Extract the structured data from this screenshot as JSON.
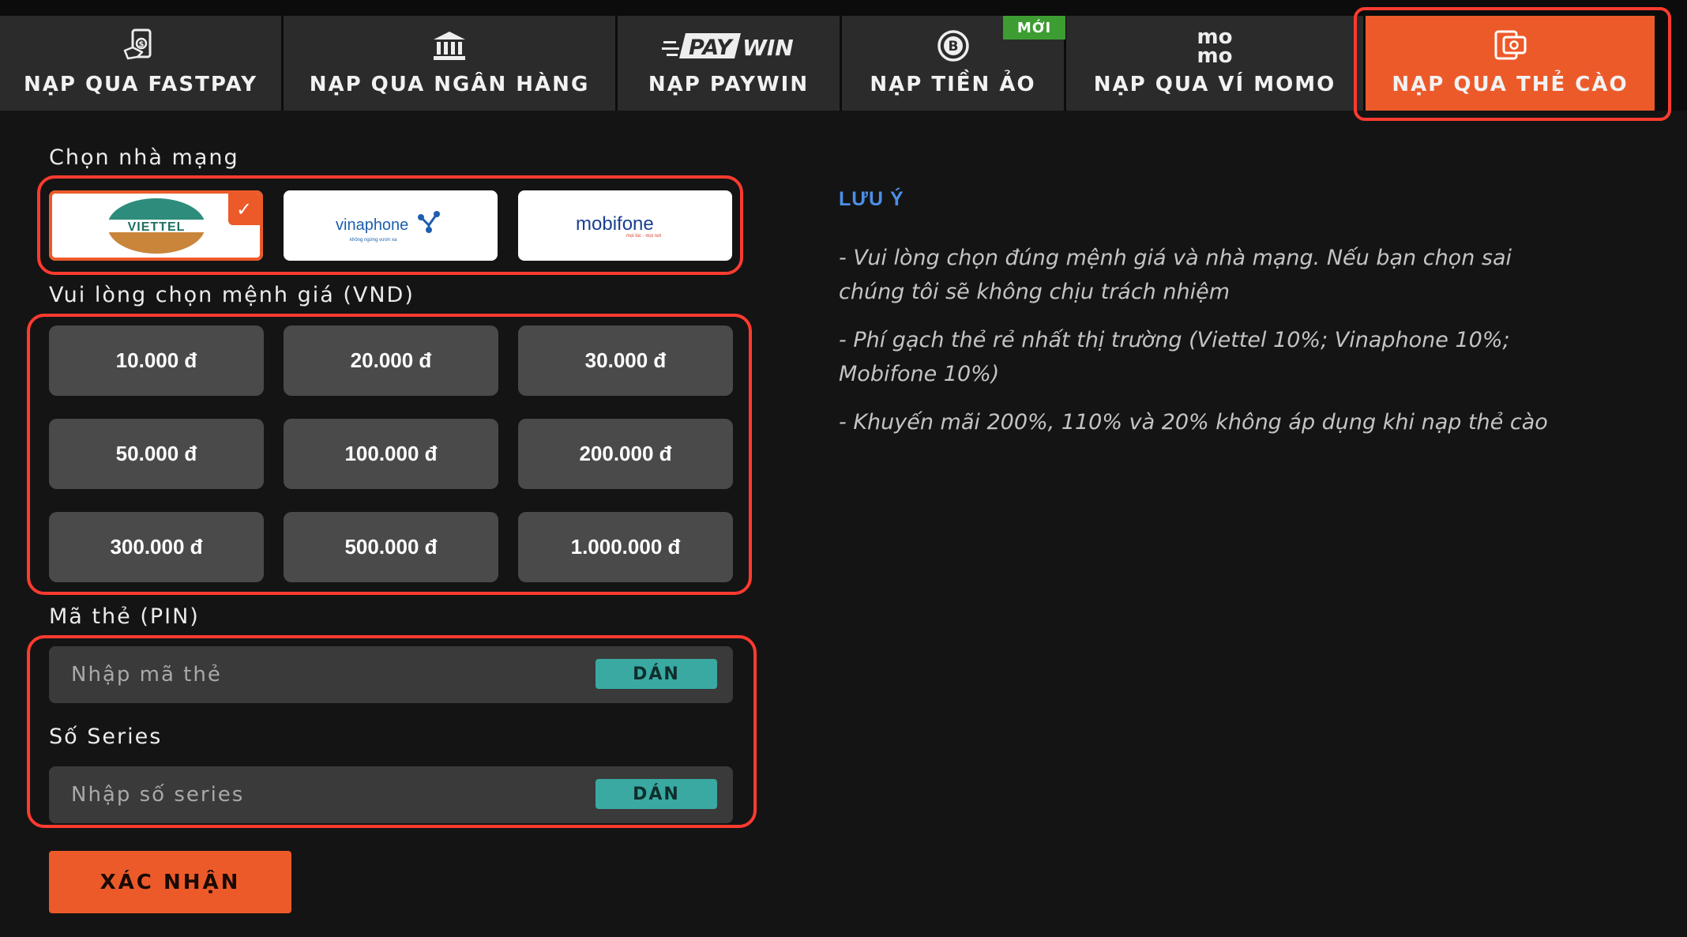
{
  "colors": {
    "accent": "#ec5a2a",
    "highlight_outline": "#ff3b30",
    "paste_button": "#3aa9a2",
    "note_title": "#4a8fe7",
    "new_badge": "#3d9d32"
  },
  "tabs": [
    {
      "label": "NẠP QUA FASTPAY",
      "icon": "money-hand-icon"
    },
    {
      "label": "NẠP QUA NGÂN HÀNG",
      "icon": "bank-icon"
    },
    {
      "label": "NẠP PAYWIN",
      "icon": "paywin-logo",
      "logo_text": [
        "PAY",
        "WIN"
      ]
    },
    {
      "label": "NẠP TIỀN ẢO",
      "icon": "bitcoin-icon"
    },
    {
      "label": "NẠP QUA VÍ MOMO",
      "icon": "momo-logo",
      "logo_text": [
        "mo",
        "mo"
      ]
    },
    {
      "label": "NẠP QUA THẺ CÀO",
      "icon": "card-icon",
      "active": true
    }
  ],
  "new_badge": "MỚI",
  "carrier_section": {
    "label": "Chọn nhà mạng",
    "carriers": [
      {
        "name": "viettel",
        "logo_text": "VIETTEL",
        "selected": true
      },
      {
        "name": "vinaphone",
        "logo_text": "vinaphone",
        "tagline": "không ngừng vươn xa"
      },
      {
        "name": "mobifone",
        "logo_text": "mobifone",
        "tagline": "mọi lúc - mọi nơi"
      }
    ]
  },
  "amount_section": {
    "label": "Vui lòng chọn mệnh giá (VND)",
    "amounts": [
      "10.000 đ",
      "20.000 đ",
      "30.000 đ",
      "50.000 đ",
      "100.000 đ",
      "200.000 đ",
      "300.000 đ",
      "500.000 đ",
      "1.000.000 đ"
    ]
  },
  "pin": {
    "label": "Mã thẻ (PIN)",
    "placeholder": "Nhập mã thẻ",
    "paste_label": "DÁN"
  },
  "serial": {
    "label": "Số Series",
    "placeholder": "Nhập số series",
    "paste_label": "DÁN"
  },
  "confirm_label": "XÁC NHẬN",
  "note": {
    "title": "LƯU Ý",
    "items": [
      "- Vui lòng chọn đúng mệnh giá và nhà mạng. Nếu bạn chọn sai chúng tôi sẽ không chịu trách nhiệm",
      "- Phí gạch thẻ rẻ nhất thị trường (Viettel 10%; Vinaphone 10%; Mobifone 10%)",
      "- Khuyến mãi 200%, 110% và 20% không áp dụng khi nạp thẻ cào"
    ]
  }
}
